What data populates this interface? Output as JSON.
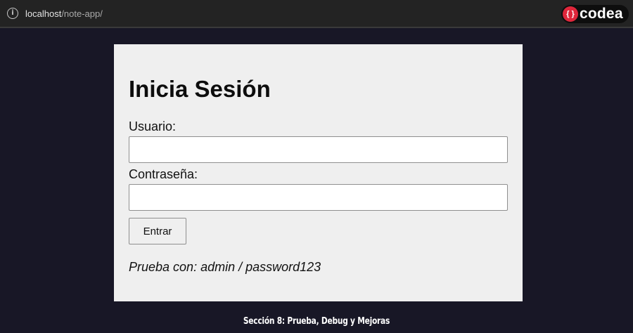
{
  "browser": {
    "url_host": "localhost",
    "url_path": "/note-app/",
    "info_icon": "info-icon"
  },
  "brand": {
    "mark": "{ }",
    "name": "codea",
    "color": "#e0263b"
  },
  "login": {
    "title": "Inicia Sesión",
    "username_label": "Usuario:",
    "username_value": "",
    "password_label": "Contraseña:",
    "password_value": "",
    "submit_label": "Entrar",
    "hint": "Prueba con: admin / password123"
  },
  "footer": {
    "caption": "Sección 8: Prueba, Debug y Mejoras"
  },
  "colors": {
    "page_background": "#181726",
    "card_background": "#efefef"
  }
}
